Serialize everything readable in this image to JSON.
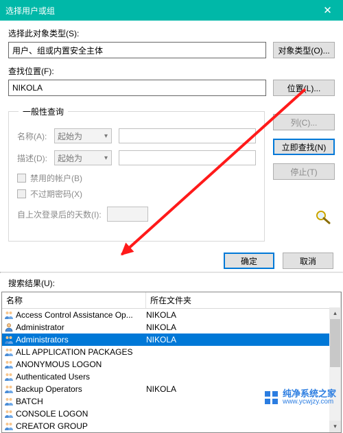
{
  "title": "选择用户或组",
  "close": "✕",
  "section_object_type_label": "选择此对象类型(S):",
  "object_type_value": "用户、组或内置安全主体",
  "object_type_btn": "对象类型(O)...",
  "section_location_label": "查找位置(F):",
  "location_value": "NIKOLA",
  "location_btn": "位置(L)...",
  "common_queries_legend": "一般性查询",
  "name_label": "名称(A):",
  "name_combo": "起始为",
  "desc_label": "描述(D):",
  "desc_combo": "起始为",
  "disabled_accounts_label": "禁用的帐户(B)",
  "non_expiring_label": "不过期密码(X)",
  "days_since_label": "自上次登录后的天数(I):",
  "columns_btn": "列(C)...",
  "find_now_btn": "立即查找(N)",
  "stop_btn": "停止(T)",
  "ok_btn": "确定",
  "cancel_btn": "取消",
  "results_label": "搜索结果(U):",
  "col_name": "名称",
  "col_folder": "所在文件夹",
  "rows": [
    {
      "name": "Access Control Assistance Op...",
      "folder": "NIKOLA",
      "type": "group"
    },
    {
      "name": "Administrator",
      "folder": "NIKOLA",
      "type": "user"
    },
    {
      "name": "Administrators",
      "folder": "NIKOLA",
      "type": "group",
      "selected": true
    },
    {
      "name": "ALL APPLICATION PACKAGES",
      "folder": "",
      "type": "group"
    },
    {
      "name": "ANONYMOUS LOGON",
      "folder": "",
      "type": "group"
    },
    {
      "name": "Authenticated Users",
      "folder": "",
      "type": "group"
    },
    {
      "name": "Backup Operators",
      "folder": "NIKOLA",
      "type": "group"
    },
    {
      "name": "BATCH",
      "folder": "",
      "type": "group"
    },
    {
      "name": "CONSOLE LOGON",
      "folder": "",
      "type": "group"
    },
    {
      "name": "CREATOR GROUP",
      "folder": "",
      "type": "group"
    }
  ],
  "watermark": {
    "cn": "纯净系统之家",
    "url": "www.ycwjzy.com"
  }
}
